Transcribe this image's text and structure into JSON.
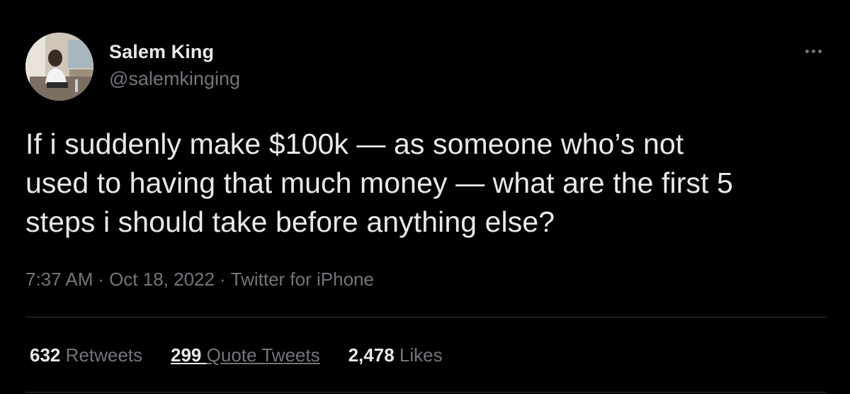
{
  "user": {
    "display_name": "Salem King",
    "handle": "@salemkinging"
  },
  "tweet": {
    "text": "If i suddenly make $100k — as someone who’s not\nused to having that much money — what are the first 5\nsteps i should take before anything else?",
    "time": "7:37 AM",
    "separator": "·",
    "date": "Oct 18, 2022",
    "source": "Twitter for iPhone"
  },
  "stats": {
    "retweets": {
      "count": "632",
      "label": "Retweets"
    },
    "quote_tweets": {
      "count": "299",
      "label": "Quote Tweets"
    },
    "likes": {
      "count": "2,478",
      "label": "Likes"
    }
  },
  "icons": {
    "more": "more-horizontal-icon",
    "avatar": "profile-photo"
  },
  "colors": {
    "background": "#000000",
    "primary_text": "#e7e9ea",
    "secondary_text": "#71767b",
    "divider": "#2f3336"
  }
}
